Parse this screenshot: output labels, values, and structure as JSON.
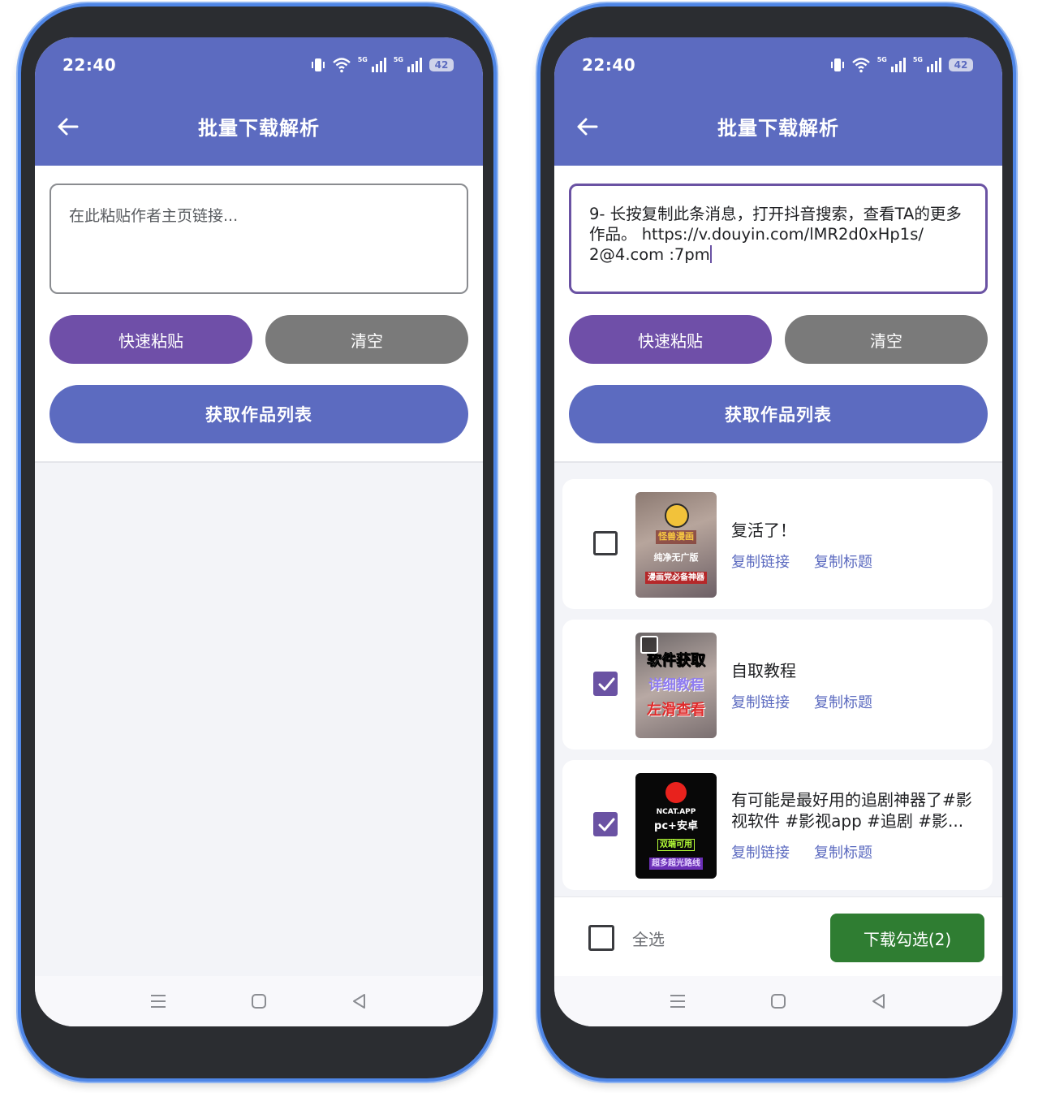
{
  "status": {
    "time": "22:40",
    "signal_label": "5G",
    "battery": "42"
  },
  "header": {
    "title": "批量下载解析"
  },
  "input": {
    "placeholder": "在此粘贴作者主页链接...",
    "value": "9- 长按复制此条消息，打开抖音搜索，查看TA的更多作品。 https://v.douyin.com/lMR2d0xHp1s/ 2@4.com :7pm"
  },
  "buttons": {
    "paste": "快速粘贴",
    "clear": "清空",
    "fetch": "获取作品列表"
  },
  "items": [
    {
      "title": "复活了！",
      "checked": false,
      "thumb_text": [
        "怪兽漫画",
        "纯净无广版",
        "漫画党必备神器"
      ]
    },
    {
      "title": "自取教程",
      "checked": true,
      "thumb_text": [
        "软件获取",
        "详细教程",
        "左滑查看"
      ]
    },
    {
      "title": "有可能是最好用的追剧神器了#影视软件 #影视app #追剧 #影...",
      "checked": true,
      "thumb_text": [
        "NCAT.APP",
        "pc+安卓",
        "双端可用",
        "超多超光路线"
      ]
    }
  ],
  "item_links": {
    "copy_link": "复制链接",
    "copy_title": "复制标题"
  },
  "footer": {
    "select_all": "全选",
    "download": "下载勾选(2)"
  },
  "colors": {
    "primary": "#5c6bc0",
    "accent_purple": "#6f4fa8",
    "gray_button": "#7a7a7a",
    "download_green": "#2f7d32"
  },
  "icons": [
    "back-arrow-icon",
    "vibrate-icon",
    "wifi-icon",
    "signal-icon",
    "battery-icon",
    "menu-icon",
    "home-icon",
    "back-triangle-icon",
    "checkmark-icon"
  ]
}
